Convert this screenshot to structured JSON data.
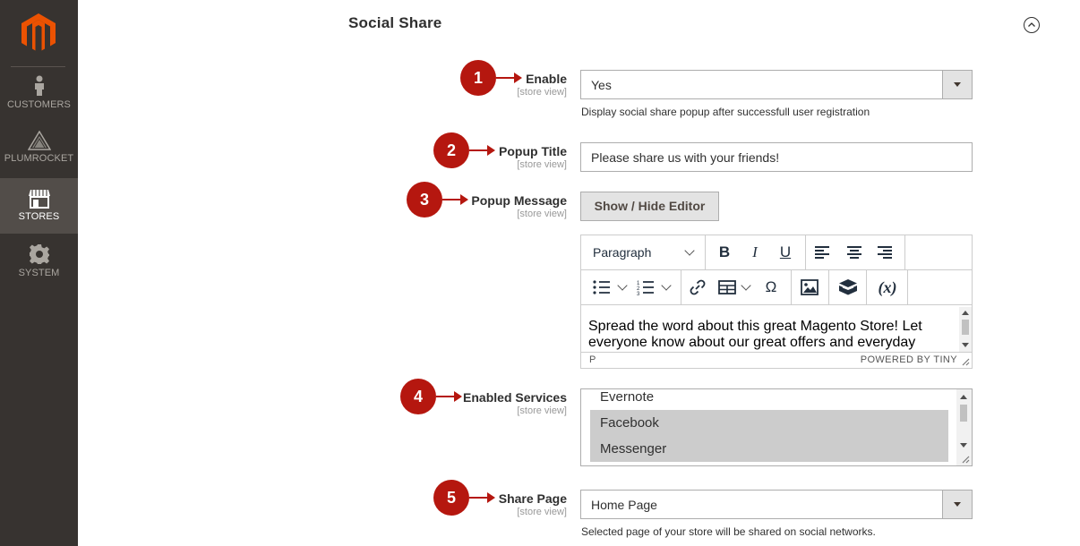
{
  "sidebar": {
    "items": [
      {
        "label": "CUSTOMERS",
        "icon": "person-icon"
      },
      {
        "label": "PLUMROCKET",
        "icon": "pyramid-icon"
      },
      {
        "label": "STORES",
        "icon": "storefront-icon",
        "active": true
      },
      {
        "label": "SYSTEM",
        "icon": "gear-icon"
      }
    ]
  },
  "section": {
    "title": "Social Share"
  },
  "fields": {
    "enable": {
      "label": "Enable",
      "scope": "[store view]",
      "value": "Yes",
      "note": "Display social share popup after successfull user registration",
      "badge": "1"
    },
    "popup_title": {
      "label": "Popup Title",
      "scope": "[store view]",
      "value": "Please share us with your friends!",
      "badge": "2"
    },
    "popup_message": {
      "label": "Popup Message",
      "scope": "[store view]",
      "badge": "3",
      "toggle_label": "Show / Hide Editor",
      "editor": {
        "format": "Paragraph",
        "content": "Spread the word about this great Magento Store! Let everyone know about our great offers and everyday",
        "status_path": "P",
        "powered_by": "POWERED BY TINY"
      }
    },
    "enabled_services": {
      "label": "Enabled Services",
      "scope": "[store view]",
      "badge": "4",
      "options": [
        "Evernote",
        "Facebook",
        "Messenger"
      ]
    },
    "share_page": {
      "label": "Share Page",
      "scope": "[store view]",
      "value": "Home Page",
      "note": "Selected page of your store will be shared on social networks.",
      "badge": "5"
    }
  },
  "colors": {
    "badge": "#b5170f",
    "sidebar": "#373330",
    "logo": "#eb5202"
  }
}
